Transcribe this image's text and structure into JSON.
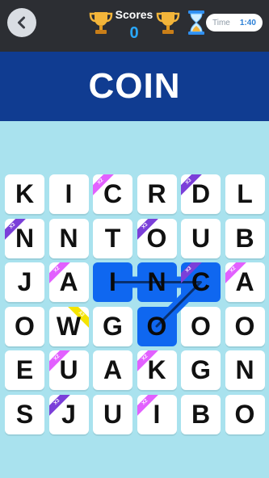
{
  "header": {
    "scores_label": "Scores",
    "scores_value": "0",
    "timer_label": "Time",
    "timer_value": "1:40"
  },
  "banner": {
    "word": "COIN"
  },
  "colors": {
    "banner_bg": "#103c91",
    "selected_tile": "#0f67f0",
    "score_blue": "#29a8ff",
    "multiplier_magenta": "#e260ff",
    "multiplier_purple": "#7b3fd9",
    "multiplier_yellow": "#f5e400"
  },
  "grid": {
    "rows": [
      [
        {
          "letter": "K"
        },
        {
          "letter": "I"
        },
        {
          "letter": "C",
          "ribbon": {
            "side": "tl",
            "color": "magenta",
            "text": "X2"
          }
        },
        {
          "letter": "R"
        },
        {
          "letter": "D",
          "ribbon": {
            "side": "tl",
            "color": "purple",
            "text": "X3"
          }
        },
        {
          "letter": "L"
        }
      ],
      [
        {
          "letter": "N",
          "ribbon": {
            "side": "tl",
            "color": "purple",
            "text": "X3"
          }
        },
        {
          "letter": "N"
        },
        {
          "letter": "T"
        },
        {
          "letter": "O",
          "ribbon": {
            "side": "tl",
            "color": "purple",
            "text": "X3"
          }
        },
        {
          "letter": "U"
        },
        {
          "letter": "B"
        }
      ],
      [
        {
          "letter": "J"
        },
        {
          "letter": "A",
          "ribbon": {
            "side": "tl",
            "color": "magenta",
            "text": "X2"
          }
        },
        {
          "letter": "I",
          "selected": true
        },
        {
          "letter": "N",
          "selected": true
        },
        {
          "letter": "C",
          "selected": true,
          "ribbon": {
            "side": "tl",
            "color": "purple",
            "text": "X3"
          }
        },
        {
          "letter": "A",
          "ribbon": {
            "side": "tl",
            "color": "magenta",
            "text": "X2"
          }
        }
      ],
      [
        {
          "letter": "O"
        },
        {
          "letter": "W",
          "ribbon": {
            "side": "tr",
            "color": "yellow",
            "text": "X2"
          }
        },
        {
          "letter": "G"
        },
        {
          "letter": "O",
          "selected": true
        },
        {
          "letter": "O"
        },
        {
          "letter": "O"
        }
      ],
      [
        {
          "letter": "E"
        },
        {
          "letter": "U",
          "ribbon": {
            "side": "tl",
            "color": "magenta",
            "text": "X2"
          }
        },
        {
          "letter": "A"
        },
        {
          "letter": "K",
          "ribbon": {
            "side": "tl",
            "color": "magenta",
            "text": "X2"
          }
        },
        {
          "letter": "G"
        },
        {
          "letter": "N"
        }
      ],
      [
        {
          "letter": "S"
        },
        {
          "letter": "J",
          "ribbon": {
            "side": "tl",
            "color": "purple",
            "text": "X3"
          }
        },
        {
          "letter": "U"
        },
        {
          "letter": "I",
          "ribbon": {
            "side": "tl",
            "color": "magenta",
            "text": "X2"
          }
        },
        {
          "letter": "B"
        },
        {
          "letter": "O"
        }
      ]
    ],
    "path": [
      [
        3,
        3
      ],
      [
        2,
        4
      ],
      [
        2,
        3
      ],
      [
        2,
        2
      ]
    ]
  }
}
